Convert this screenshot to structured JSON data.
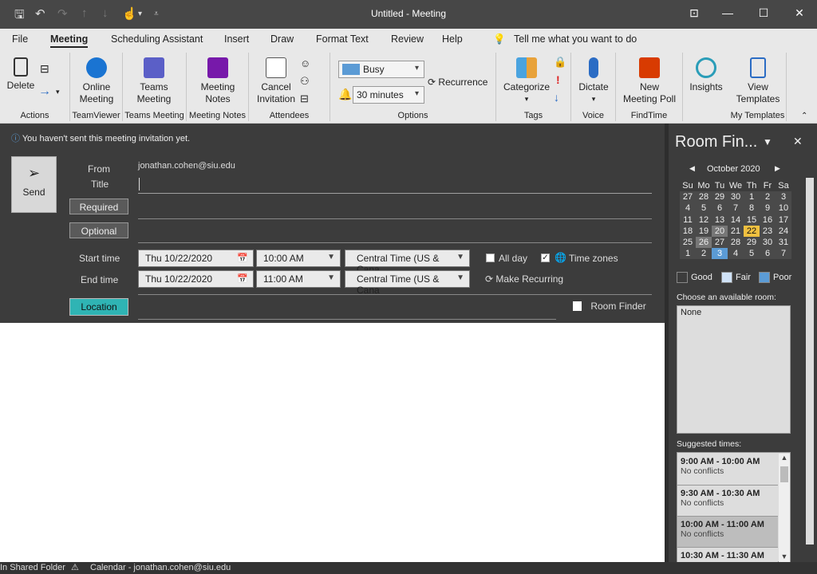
{
  "window": {
    "title": "Untitled  -  Meeting"
  },
  "menu": [
    "File",
    "Meeting",
    "Scheduling Assistant",
    "Insert",
    "Draw",
    "Format Text",
    "Review",
    "Help"
  ],
  "tell_me": "Tell me what you want to do",
  "ribbon": {
    "delete": "Delete",
    "group_actions": "Actions",
    "online_meeting": [
      "Online",
      "Meeting"
    ],
    "group_teamviewer": "TeamViewer",
    "teams_meeting": [
      "Teams",
      "Meeting"
    ],
    "group_teams": "Teams Meeting",
    "meeting_notes": [
      "Meeting",
      "Notes"
    ],
    "group_notes": "Meeting Notes",
    "cancel_invitation": [
      "Cancel",
      "Invitation"
    ],
    "group_attendees": "Attendees",
    "show_as": "Busy",
    "reminder": "30 minutes",
    "recurrence": "Recurrence",
    "group_options": "Options",
    "categorize": "Categorize",
    "group_tags": "Tags",
    "dictate": "Dictate",
    "group_voice": "Voice",
    "new_poll": [
      "New",
      "Meeting Poll"
    ],
    "group_findtime": "FindTime",
    "insights": "Insights",
    "view_templates": [
      "View",
      "Templates"
    ],
    "group_templates": "My Templates"
  },
  "info_bar": "You haven't sent this meeting invitation yet.",
  "form": {
    "send": "Send",
    "from_label": "From",
    "from_value": "jonathan.cohen@siu.edu",
    "title_label": "Title",
    "required": "Required",
    "optional": "Optional",
    "start_label": "Start time",
    "end_label": "End time",
    "start_date": "Thu 10/22/2020",
    "start_time": "10:00 AM",
    "end_date": "Thu 10/22/2020",
    "end_time": "11:00 AM",
    "tz": "Central Time (US & Cana",
    "all_day": "All day",
    "time_zones": "Time zones",
    "make_recurring": "Make Recurring",
    "location": "Location",
    "room_finder": "Room Finder"
  },
  "room_finder": {
    "title": "Room Fin...",
    "month": "October 2020",
    "dow": [
      "Su",
      "Mo",
      "Tu",
      "We",
      "Th",
      "Fr",
      "Sa"
    ],
    "weeks": [
      [
        "27",
        "28",
        "29",
        "30",
        "1",
        "2",
        "3"
      ],
      [
        "4",
        "5",
        "6",
        "7",
        "8",
        "9",
        "10"
      ],
      [
        "11",
        "12",
        "13",
        "14",
        "15",
        "16",
        "17"
      ],
      [
        "18",
        "19",
        "20",
        "21",
        "22",
        "23",
        "24"
      ],
      [
        "25",
        "26",
        "27",
        "28",
        "29",
        "30",
        "31"
      ],
      [
        "1",
        "2",
        "3",
        "4",
        "5",
        "6",
        "7"
      ]
    ],
    "legend_good": "Good",
    "legend_fair": "Fair",
    "legend_poor": "Poor",
    "choose_label": "Choose an available room:",
    "room_none": "None",
    "suggested_label": "Suggested times:",
    "suggestions": [
      {
        "time": "9:00 AM - 10:00 AM",
        "note": "No conflicts"
      },
      {
        "time": "9:30 AM - 10:30 AM",
        "note": "No conflicts"
      },
      {
        "time": "10:00 AM - 11:00 AM",
        "note": "No conflicts"
      },
      {
        "time": "10:30 AM - 11:30 AM",
        "note": ""
      }
    ]
  },
  "status": {
    "left": "In Shared Folder",
    "calendar": "Calendar - jonathan.cohen@siu.edu"
  },
  "colors": {
    "accent": "#2fb4b4",
    "today": "#f0c040",
    "selected": "#5b9bd5"
  }
}
